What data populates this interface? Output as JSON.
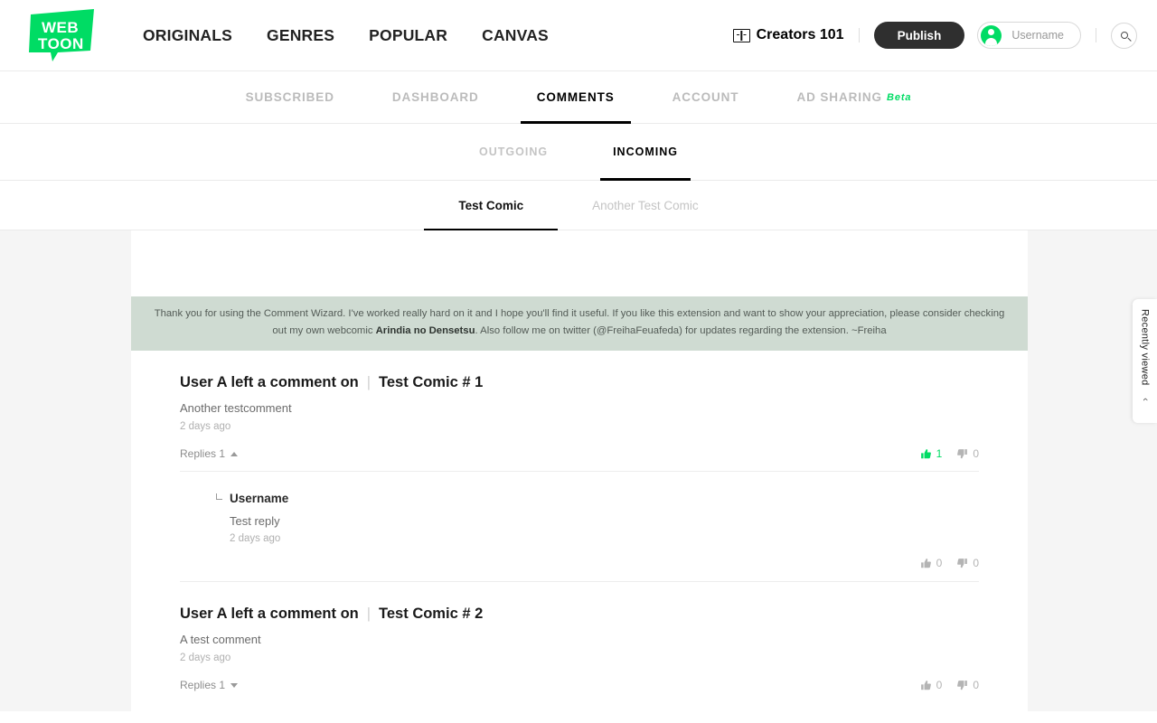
{
  "header": {
    "logo_line1": "WEB",
    "logo_line2": "TOON",
    "nav": [
      {
        "label": "ORIGINALS"
      },
      {
        "label": "GENRES"
      },
      {
        "label": "POPULAR"
      },
      {
        "label": "CANVAS"
      }
    ],
    "creators_label": "Creators 101",
    "publish_label": "Publish",
    "username": "Username",
    "search_icon": "search-icon",
    "accent_color": "#00dc64",
    "publish_bg": "#2f2f2f"
  },
  "tabs_primary": [
    {
      "label": "SUBSCRIBED",
      "active": false
    },
    {
      "label": "DASHBOARD",
      "active": false
    },
    {
      "label": "COMMENTS",
      "active": true
    },
    {
      "label": "ACCOUNT",
      "active": false
    },
    {
      "label": "AD SHARING",
      "badge": "Beta",
      "active": false
    }
  ],
  "tabs_secondary": [
    {
      "label": "OUTGOING",
      "active": false
    },
    {
      "label": "INCOMING",
      "active": true
    }
  ],
  "tabs_comic": [
    {
      "label": "Test Comic",
      "active": true
    },
    {
      "label": "Another Test Comic",
      "active": false
    }
  ],
  "notice": {
    "part1": "Thank you for using the Comment Wizard. I've worked really hard on it and I hope you'll find it useful. If you like this extension and want to show your appreciation, please consider checking out my own webcomic ",
    "bold": "Arindia no Densetsu",
    "part2": ". Also follow me on twitter (@FreihaFeuafeda) for updates regarding the extension. ~Freiha",
    "bg_color": "#cfdbd2"
  },
  "comments": [
    {
      "author_line": "User A left a comment on",
      "separator": "|",
      "target": "Test Comic  # 1",
      "body": "Another testcomment",
      "time": "2 days ago",
      "replies_label": "Replies 1",
      "expanded": true,
      "likes": "1",
      "dislikes": "0",
      "liked": true,
      "reply": {
        "name": "Username",
        "body": "Test reply",
        "time": "2 days ago",
        "likes": "0",
        "dislikes": "0"
      }
    },
    {
      "author_line": "User A left a comment on",
      "separator": "|",
      "target": "Test Comic  # 2",
      "body": "A test comment",
      "time": "2 days ago",
      "replies_label": "Replies 1",
      "expanded": false,
      "likes": "0",
      "dislikes": "0",
      "liked": false
    }
  ],
  "recently_viewed": {
    "label": "Recently viewed",
    "chevron": "‹"
  }
}
